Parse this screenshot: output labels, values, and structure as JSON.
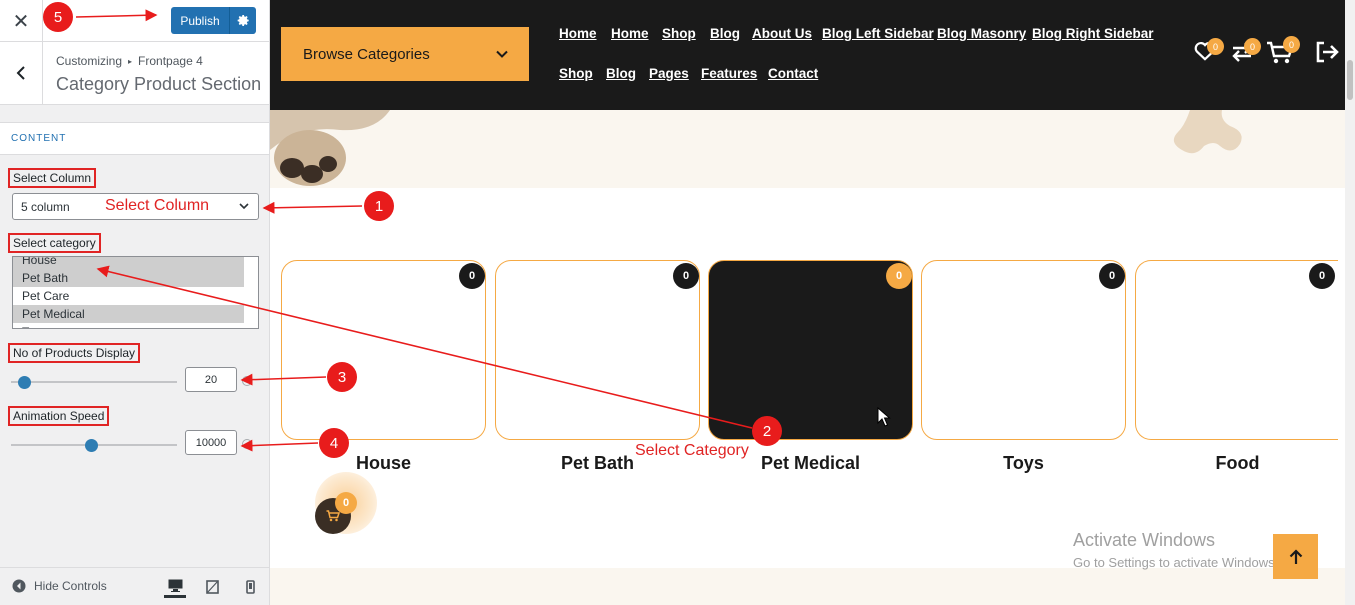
{
  "customizer": {
    "close_label": "✕",
    "publish_label": "Publish",
    "breadcrumb": {
      "root": "Customizing",
      "sep": "▸",
      "page": "Frontpage 4"
    },
    "section_title": "Category Product Section",
    "content_heading": "CONTENT",
    "select_column": {
      "label": "Select Column",
      "value": "5 column",
      "hint": "Select Column"
    },
    "select_category": {
      "label": "Select category",
      "options": [
        {
          "label": "House",
          "selected": true
        },
        {
          "label": "Pet Bath",
          "selected": true
        },
        {
          "label": "Pet Care",
          "selected": false
        },
        {
          "label": "Pet Medical",
          "selected": true
        },
        {
          "label": "Toys",
          "selected": false
        }
      ]
    },
    "products_display": {
      "label": "No of Products Display",
      "value": "20",
      "slider_fraction": 0.08
    },
    "animation_speed": {
      "label": "Animation Speed",
      "value": "10000",
      "slider_fraction": 0.48
    },
    "hide_controls": "Hide Controls",
    "devices": [
      "desktop-icon",
      "tablet-icon",
      "mobile-icon"
    ]
  },
  "site": {
    "browse_label": "Browse Categories",
    "nav_row1": [
      "Home",
      "Home",
      "Shop",
      "Blog",
      "About Us",
      "Blog Left Sidebar",
      "Blog Masonry",
      "Blog Right Sidebar"
    ],
    "nav_row2": [
      "Shop",
      "Blog",
      "Pages",
      "Features",
      "Contact"
    ],
    "wishlist_count": "0",
    "compare_count": "0",
    "cart_count": "0",
    "categories": [
      {
        "name": "House",
        "count": "0",
        "active": false
      },
      {
        "name": "Pet Bath",
        "count": "0",
        "active": false
      },
      {
        "name": "Pet Medical",
        "count": "0",
        "active": true
      },
      {
        "name": "Toys",
        "count": "0",
        "active": false
      },
      {
        "name": "Food",
        "count": "0",
        "active": false
      }
    ],
    "floating_cart_count": "0",
    "windows_title": "Activate Windows",
    "windows_sub": "Go to Settings to activate Windows."
  },
  "annotations": {
    "numbers": [
      "1",
      "2",
      "3",
      "4",
      "5"
    ],
    "category_hint": "Select Category"
  },
  "colors": {
    "accent": "#f5a944",
    "dark": "#1a1a1a",
    "wp_blue": "#2271b1",
    "annotation_red": "#e81c1c"
  }
}
